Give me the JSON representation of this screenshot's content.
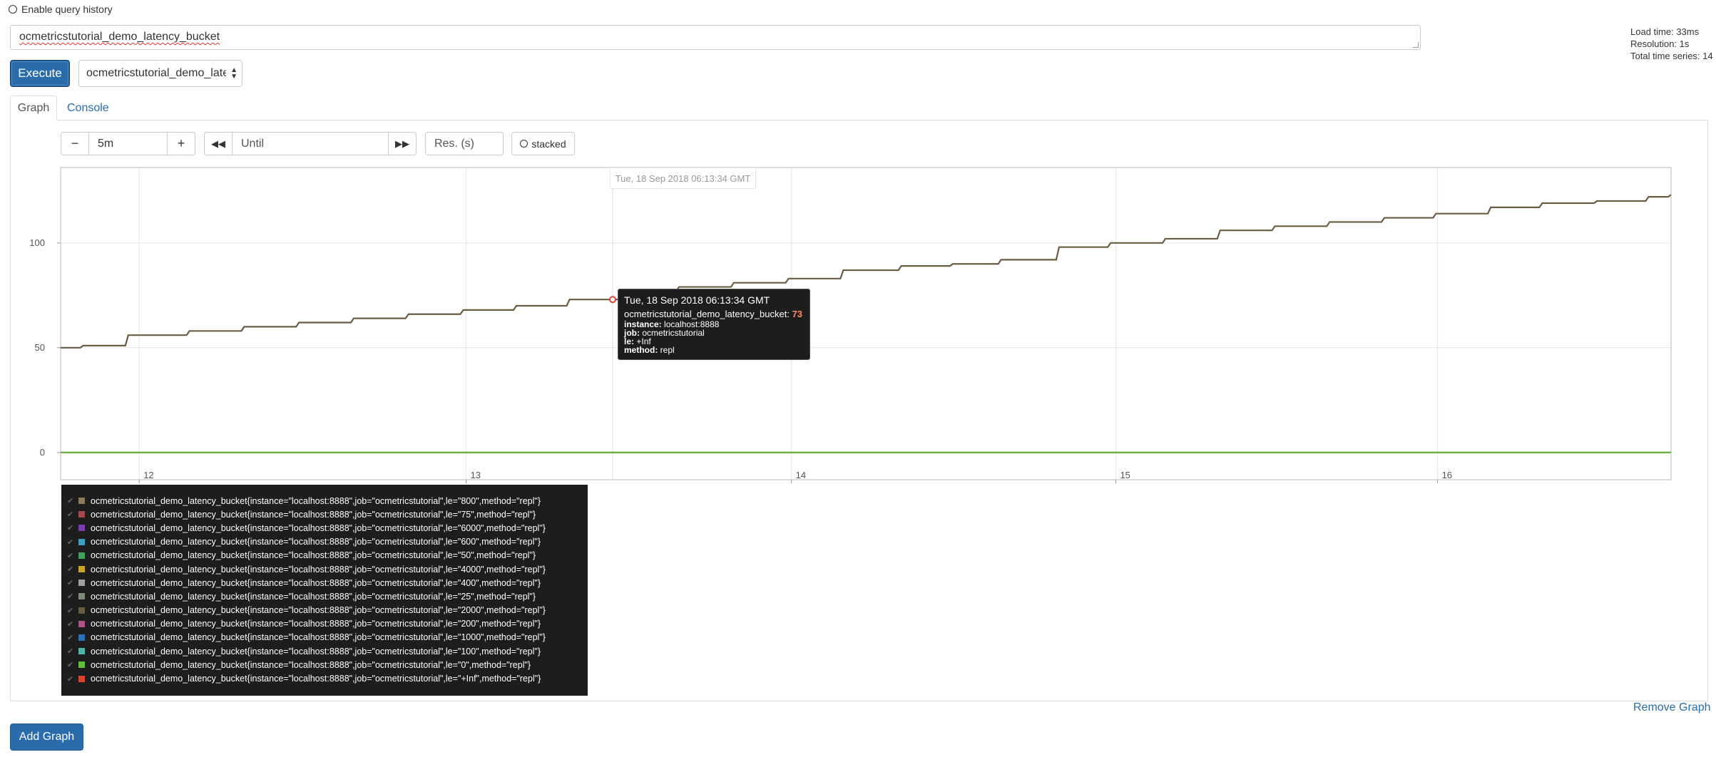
{
  "header": {
    "history_label": "Enable query history"
  },
  "stats": {
    "load_time": "Load time: 33ms",
    "resolution": "Resolution: 1s",
    "total_series": "Total time series: 14"
  },
  "query": {
    "expression": "ocmetricstutorial_demo_latency_bucket",
    "execute_label": "Execute",
    "metric_select_value": "ocmetricstutorial_demo_latency_bucket"
  },
  "tabs": {
    "graph": "Graph",
    "console": "Console"
  },
  "controls": {
    "minus": "−",
    "range_value": "5m",
    "plus": "+",
    "back": "◀◀",
    "until_placeholder": "Until",
    "forward": "▶▶",
    "res_placeholder": "Res. (s)",
    "stacked_label": "stacked"
  },
  "chart_data": {
    "type": "line",
    "x_ticks": [
      "12",
      "13",
      "14",
      "15",
      "16"
    ],
    "y_ticks": [
      "0",
      "50",
      "100"
    ],
    "ylim": [
      -13,
      136
    ],
    "hover_time": "Tue, 18 Sep 2018 06:13:34 GMT",
    "series": [
      {
        "name": "ocmetricstutorial_demo_latency_bucket{instance=\"localhost:8888\",job=\"ocmetricstutorial\",le=\"+Inf\",method=\"repl\"}",
        "color": "#6b5b43",
        "steps": [
          [
            0.0,
            50
          ],
          [
            7.0,
            51
          ],
          [
            21.0,
            56
          ],
          [
            40.0,
            58
          ],
          [
            57.0,
            60
          ],
          [
            74.0,
            62
          ],
          [
            91.0,
            64
          ],
          [
            108.0,
            66
          ],
          [
            125.0,
            68
          ],
          [
            141.5,
            70
          ],
          [
            158.0,
            73
          ],
          [
            176.0,
            77
          ],
          [
            192.0,
            79
          ],
          [
            209.0,
            81
          ],
          [
            226.0,
            83
          ],
          [
            243.0,
            87
          ],
          [
            261.0,
            89
          ],
          [
            277.0,
            90
          ],
          [
            292.0,
            92
          ],
          [
            310.0,
            98
          ],
          [
            326.0,
            100
          ],
          [
            343.0,
            102
          ],
          [
            360.0,
            106
          ],
          [
            377.0,
            108
          ],
          [
            394.0,
            110
          ],
          [
            411.0,
            112
          ],
          [
            427.0,
            114
          ],
          [
            444.0,
            117
          ],
          [
            460.0,
            119
          ],
          [
            477.0,
            120
          ],
          [
            493.0,
            122
          ],
          [
            500.0,
            123
          ]
        ]
      },
      {
        "name": "ocmetricstutorial_demo_latency_bucket{instance=\"localhost:8888\",job=\"ocmetricstutorial\",le=\"0\",method=\"repl\"}",
        "color": "#5fae3a",
        "steps": [
          [
            0.0,
            0
          ],
          [
            500.0,
            0
          ]
        ]
      }
    ]
  },
  "tooltip": {
    "time": "Tue, 18 Sep 2018 06:13:34 GMT",
    "metric": "ocmetricstutorial_demo_latency_bucket:",
    "value": "73",
    "instance_key": "instance:",
    "instance_val": "localhost:8888",
    "job_key": "job:",
    "job_val": "ocmetricstutorial",
    "le_key": "le:",
    "le_val": "+Inf",
    "method_key": "method:",
    "method_val": "repl"
  },
  "legend": [
    {
      "label": "ocmetricstutorial_demo_latency_bucket{instance=\"localhost:8888\",job=\"ocmetricstutorial\",le=\"800\",method=\"repl\"}",
      "color": "#8c7a5b"
    },
    {
      "label": "ocmetricstutorial_demo_latency_bucket{instance=\"localhost:8888\",job=\"ocmetricstutorial\",le=\"75\",method=\"repl\"}",
      "color": "#a9484a"
    },
    {
      "label": "ocmetricstutorial_demo_latency_bucket{instance=\"localhost:8888\",job=\"ocmetricstutorial\",le=\"6000\",method=\"repl\"}",
      "color": "#7a3bb0"
    },
    {
      "label": "ocmetricstutorial_demo_latency_bucket{instance=\"localhost:8888\",job=\"ocmetricstutorial\",le=\"600\",method=\"repl\"}",
      "color": "#3f9fc1"
    },
    {
      "label": "ocmetricstutorial_demo_latency_bucket{instance=\"localhost:8888\",job=\"ocmetricstutorial\",le=\"50\",method=\"repl\"}",
      "color": "#3fa15a"
    },
    {
      "label": "ocmetricstutorial_demo_latency_bucket{instance=\"localhost:8888\",job=\"ocmetricstutorial\",le=\"4000\",method=\"repl\"}",
      "color": "#c9a52b"
    },
    {
      "label": "ocmetricstutorial_demo_latency_bucket{instance=\"localhost:8888\",job=\"ocmetricstutorial\",le=\"400\",method=\"repl\"}",
      "color": "#a0a0a0"
    },
    {
      "label": "ocmetricstutorial_demo_latency_bucket{instance=\"localhost:8888\",job=\"ocmetricstutorial\",le=\"25\",method=\"repl\"}",
      "color": "#7d8a78"
    },
    {
      "label": "ocmetricstutorial_demo_latency_bucket{instance=\"localhost:8888\",job=\"ocmetricstutorial\",le=\"2000\",method=\"repl\"}",
      "color": "#6b5b43"
    },
    {
      "label": "ocmetricstutorial_demo_latency_bucket{instance=\"localhost:8888\",job=\"ocmetricstutorial\",le=\"200\",method=\"repl\"}",
      "color": "#b0538a"
    },
    {
      "label": "ocmetricstutorial_demo_latency_bucket{instance=\"localhost:8888\",job=\"ocmetricstutorial\",le=\"1000\",method=\"repl\"}",
      "color": "#2f6fb8"
    },
    {
      "label": "ocmetricstutorial_demo_latency_bucket{instance=\"localhost:8888\",job=\"ocmetricstutorial\",le=\"100\",method=\"repl\"}",
      "color": "#4fb3a9"
    },
    {
      "label": "ocmetricstutorial_demo_latency_bucket{instance=\"localhost:8888\",job=\"ocmetricstutorial\",le=\"0\",method=\"repl\"}",
      "color": "#5fbf3a"
    },
    {
      "label": "ocmetricstutorial_demo_latency_bucket{instance=\"localhost:8888\",job=\"ocmetricstutorial\",le=\"+Inf\",method=\"repl\"}",
      "color": "#d9452e"
    }
  ],
  "footer": {
    "remove_graph": "Remove Graph",
    "add_graph": "Add Graph"
  }
}
